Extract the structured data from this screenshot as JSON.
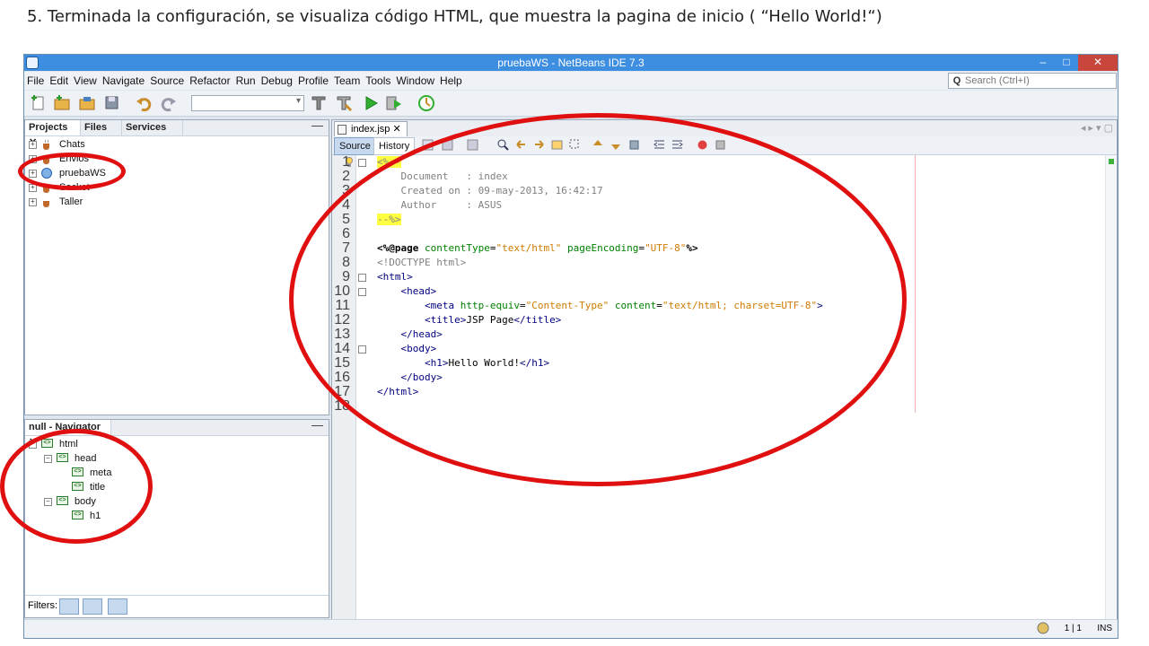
{
  "caption": "5. Terminada la configuración, se visualiza código HTML, que muestra la pagina de inicio ( “Hello World!“)",
  "window": {
    "title": "pruebaWS - NetBeans IDE 7.3",
    "buttons": {
      "minimize": "–",
      "maximize": "□",
      "close": "✕"
    }
  },
  "menu": [
    "File",
    "Edit",
    "View",
    "Navigate",
    "Source",
    "Refactor",
    "Run",
    "Debug",
    "Profile",
    "Team",
    "Tools",
    "Window",
    "Help"
  ],
  "search": {
    "placeholder": "Search (Ctrl+I)"
  },
  "toolbar_icons": [
    "new-file-icon",
    "new-project-icon",
    "open-project-icon",
    "save-all-icon",
    "undo-icon",
    "redo-icon",
    "clean-build-icon",
    "build-icon",
    "run-icon",
    "debug-icon",
    "profile-icon"
  ],
  "projects_panel": {
    "tabs": [
      "Projects",
      "Files",
      "Services"
    ],
    "close": "✕",
    "minimize": "—",
    "items": [
      "Chats",
      "Envios",
      "pruebaWS",
      "Socket",
      "Taller"
    ]
  },
  "navigator_panel": {
    "tab": "null - Navigator",
    "close": "✕",
    "minimize": "—",
    "tree": [
      "html",
      "head",
      "meta",
      "title",
      "body",
      "h1"
    ],
    "filters_label": "Filters:"
  },
  "editor": {
    "tab": "index.jsp",
    "tab_close": "✕",
    "modes": [
      "Source",
      "History"
    ],
    "lines": [
      {
        "n": "1",
        "parts": [
          [
            "hl c-com",
            "<%--"
          ]
        ]
      },
      {
        "n": "2",
        "parts": [
          [
            "c-com",
            "    Document   : index"
          ]
        ]
      },
      {
        "n": "3",
        "parts": [
          [
            "c-com",
            "    Created on : 09-may-2013, 16:42:17"
          ]
        ]
      },
      {
        "n": "4",
        "parts": [
          [
            "c-com",
            "    Author     : ASUS"
          ]
        ]
      },
      {
        "n": "5",
        "parts": [
          [
            "hl c-com",
            "--%>"
          ]
        ]
      },
      {
        "n": "6",
        "parts": []
      },
      {
        "n": "7",
        "parts": [
          [
            "c-dir",
            "<%@page "
          ],
          [
            "c-attr",
            "contentType"
          ],
          [
            "",
            "="
          ],
          [
            "c-val",
            "\"text/html\""
          ],
          [
            "",
            " "
          ],
          [
            "c-attr",
            "pageEncoding"
          ],
          [
            "",
            "="
          ],
          [
            "c-val",
            "\"UTF-8\""
          ],
          [
            "c-dir",
            "%>"
          ]
        ]
      },
      {
        "n": "8",
        "parts": [
          [
            "c-doc",
            "<!DOCTYPE html>"
          ]
        ]
      },
      {
        "n": "9",
        "parts": [
          [
            "c-tag",
            "<html>"
          ]
        ]
      },
      {
        "n": "10",
        "parts": [
          [
            "c-tag",
            "    <head>"
          ]
        ]
      },
      {
        "n": "11",
        "parts": [
          [
            "c-tag",
            "        <meta "
          ],
          [
            "c-attr",
            "http-equiv"
          ],
          [
            "",
            "="
          ],
          [
            "c-val",
            "\"Content-Type\""
          ],
          [
            "",
            " "
          ],
          [
            "c-attr",
            "content"
          ],
          [
            "",
            "="
          ],
          [
            "c-val",
            "\"text/html; charset=UTF-8\""
          ],
          [
            "c-tag",
            ">"
          ]
        ]
      },
      {
        "n": "12",
        "parts": [
          [
            "c-tag",
            "        <title>"
          ],
          [
            "",
            "JSP Page"
          ],
          [
            "c-tag",
            "</title>"
          ]
        ]
      },
      {
        "n": "13",
        "parts": [
          [
            "c-tag",
            "    </head>"
          ]
        ]
      },
      {
        "n": "14",
        "parts": [
          [
            "c-tag",
            "    <body>"
          ]
        ]
      },
      {
        "n": "15",
        "parts": [
          [
            "c-tag",
            "        <h1>"
          ],
          [
            "",
            "Hello World!"
          ],
          [
            "c-tag",
            "</h1>"
          ]
        ]
      },
      {
        "n": "16",
        "parts": [
          [
            "c-tag",
            "    </body>"
          ]
        ]
      },
      {
        "n": "17",
        "parts": [
          [
            "c-tag",
            "</html>"
          ]
        ]
      },
      {
        "n": "18",
        "parts": []
      }
    ]
  },
  "status": {
    "position": "1 | 1",
    "mode": "INS"
  },
  "colors": {
    "annotation": "#e01010",
    "titlebar": "#3d8ee0"
  }
}
